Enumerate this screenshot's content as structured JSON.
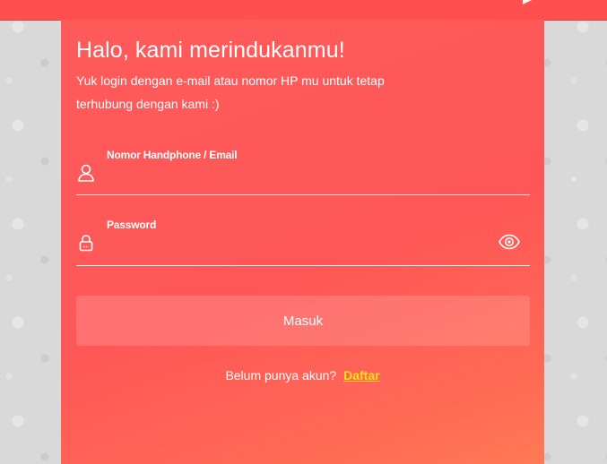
{
  "header": {
    "title": "Halo, kami merindukanmu!",
    "subtitle": "Yuk login dengan e-mail atau nomor HP mu untuk tetap terhubung dengan kami :)"
  },
  "form": {
    "phone_email_label": "Nomor Handphone / Email",
    "phone_email_value": "",
    "password_label": "Password",
    "password_value": "",
    "submit_label": "Masuk"
  },
  "signup": {
    "prompt": "Belum punya akun?",
    "link_label": "Daftar"
  },
  "icons": {
    "user": "user-icon",
    "lock": "lock-icon",
    "eye": "eye-icon",
    "top": "send-icon"
  },
  "colors": {
    "primary": "#ff5757",
    "accent_link": "#ffe21a",
    "text": "#ffffff"
  }
}
